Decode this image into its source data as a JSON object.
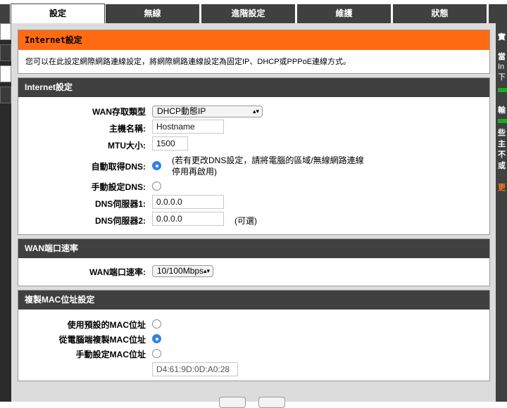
{
  "tabs": [
    {
      "label": "設定"
    },
    {
      "label": "無線"
    },
    {
      "label": "進階設定"
    },
    {
      "label": "維護"
    },
    {
      "label": "狀態"
    }
  ],
  "internet_section": {
    "header": "Internet設定",
    "description": "您可以在此設定網際網路連線設定，將網際網路連線設定為固定IP、DHCP或PPPoE連線方式。"
  },
  "internet_settings": {
    "header": "Internet設定",
    "wan_type_label": "WAN存取類型",
    "wan_type_value": "DHCP動態IP",
    "hostname_label": "主機名稱:",
    "hostname_value": "Hostname",
    "mtu_label": "MTU大小:",
    "mtu_value": "1500",
    "auto_dns_label": "自動取得DNS:",
    "auto_dns_note_line1": "(若有更改DNS設定，請將電腦的區域/無線網路連線",
    "auto_dns_note_line2": "停用再啟用)",
    "manual_dns_label": "手動設定DNS:",
    "dns1_label": "DNS伺服器1:",
    "dns1_value": "0.0.0.0",
    "dns2_label": "DNS伺服器2:",
    "dns2_value": "0.0.0.0",
    "dns2_optional": "(可選)"
  },
  "wan_port": {
    "header": "WAN端口速率",
    "speed_label": "WAN端口速率:",
    "speed_value": "10/100Mbps"
  },
  "mac_clone": {
    "header": "複製MAC位址設定",
    "default_mac_label": "使用預設的MAC位址",
    "clone_pc_mac_label": "從電腦端複製MAC位址",
    "manual_mac_label": "手動設定MAC位址",
    "mac_value": "D4:61:9D:0D:A0:28"
  },
  "right_panel": {
    "lines": [
      "實",
      "當",
      "In",
      "下",
      "輸",
      "些",
      "主",
      "不",
      "或",
      "更"
    ]
  },
  "colors": {
    "orange": "#ff6a13",
    "dark_header": "#404040",
    "radio_selected": "#2f84e4",
    "status_green": "#1faa1f"
  }
}
